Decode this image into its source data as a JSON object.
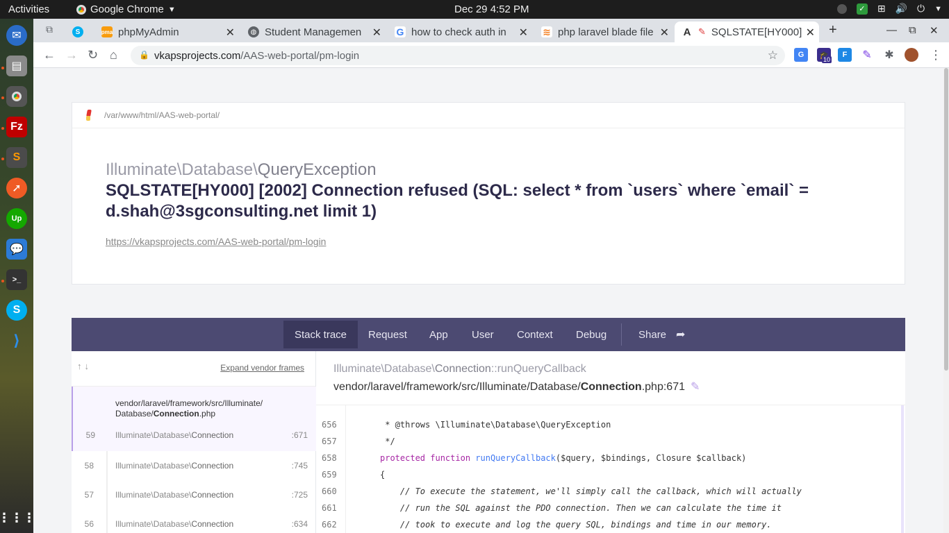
{
  "topbar": {
    "activities": "Activities",
    "app_name": "Google Chrome",
    "clock": "Dec 29   4:52 PM"
  },
  "tabs": [
    {
      "label": "",
      "fav": "S"
    },
    {
      "label": "phpMyAdmin",
      "fav": "pma"
    },
    {
      "label": "Student Managemen",
      "fav": "globe"
    },
    {
      "label": "how to check auth in",
      "fav": "G"
    },
    {
      "label": "php laravel blade file",
      "fav": "so"
    },
    {
      "label": "SQLSTATE[HY000]",
      "fav": "A"
    }
  ],
  "omnibox": {
    "host": "vkapsprojects.com",
    "path": "/AAS-web-portal/pm-login"
  },
  "extensions": {
    "badge_count": "10"
  },
  "header": {
    "path": "/var/www/html/AAS-web-portal/",
    "exception_namespace": "Illuminate\\Database\\",
    "exception_name": "QueryException",
    "message": "SQLSTATE[HY000] [2002] Connection refused (SQL: select * from `users` where `email` = d.shah@3sgconsulting.net limit 1)",
    "url": "https://vkapsprojects.com/AAS-web-portal/pm-login"
  },
  "nav": {
    "stack_trace": "Stack trace",
    "request": "Request",
    "app": "App",
    "user": "User",
    "context": "Context",
    "debug": "Debug",
    "share": "Share"
  },
  "stack": {
    "expand_label": "Expand vendor frames",
    "selected_file_prefix": "vendor/laravel/framework/src/Illuminate/",
    "selected_file_dir": "Database/",
    "selected_file_name": "Connection",
    "selected_file_ext": ".php",
    "frames": [
      {
        "num": "59",
        "ns": "Illuminate\\Database\\",
        "cls": "Connection",
        "line": ":671"
      },
      {
        "num": "58",
        "ns": "Illuminate\\Database\\",
        "cls": "Connection",
        "line": ":745"
      },
      {
        "num": "57",
        "ns": "Illuminate\\Database\\",
        "cls": "Connection",
        "line": ":725"
      },
      {
        "num": "56",
        "ns": "Illuminate\\Database\\",
        "cls": "Connection",
        "line": ":634"
      }
    ]
  },
  "code": {
    "class_ns": "Illuminate\\Database\\",
    "class_name": "Connection",
    "method": "::runQueryCallback",
    "file_prefix": "vendor/laravel/framework/src/Illuminate/Database/",
    "file_name": "Connection",
    "file_suffix": ".php:671",
    "lines": [
      {
        "n": "656",
        "text": " * @throws \\Illuminate\\Database\\QueryException"
      },
      {
        "n": "657",
        "text": " */"
      },
      {
        "n": "658",
        "text": "protected function runQueryCallback($query, $bindings, Closure $callback)"
      },
      {
        "n": "659",
        "text": "{"
      },
      {
        "n": "660",
        "text": "    // To execute the statement, we'll simply call the callback, which will actually"
      },
      {
        "n": "661",
        "text": "    // run the SQL against the PDO connection. Then we can calculate the time it"
      },
      {
        "n": "662",
        "text": "    // took to execute and log the query SQL, bindings and time in our memory."
      }
    ]
  }
}
